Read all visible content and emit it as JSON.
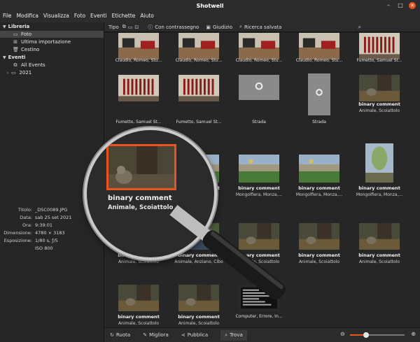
{
  "window": {
    "title": "Shotwell"
  },
  "menu": [
    "File",
    "Modifica",
    "Visualizza",
    "Foto",
    "Eventi",
    "Etichette",
    "Aiuto"
  ],
  "sidebar": {
    "libreria_label": "Libreria",
    "items": [
      {
        "label": "Foto",
        "icon": "photo-icon",
        "selected": true
      },
      {
        "label": "Ultima importazione",
        "icon": "import-icon",
        "selected": false
      },
      {
        "label": "Cestino",
        "icon": "trash-icon",
        "selected": false
      }
    ],
    "eventi_label": "Eventi",
    "events": [
      {
        "label": "All Events",
        "icon": "events-icon"
      },
      {
        "label": "2021",
        "icon": "folder-icon"
      }
    ]
  },
  "metadata": [
    {
      "key": "Titolo:",
      "value": "_DSC0089.JPG"
    },
    {
      "key": "Data:",
      "value": "sab 25 set 2021"
    },
    {
      "key": "Ora:",
      "value": "9:39:01"
    },
    {
      "key": "Dimensione:",
      "value": "4780 × 3183"
    },
    {
      "key": "Esposizione:",
      "value": "1/80 s, ƒ/5"
    },
    {
      "key": "",
      "value": "ISO 800"
    }
  ],
  "toolbar": {
    "tipo_label": "Tipo",
    "flagged_label": "Con contrassegno",
    "rating_label": "Giudizio",
    "saved_search_label": "Ricerca salvata"
  },
  "grid": {
    "rows": [
      [
        {
          "line1": "Claudio, Romeo, Stu...",
          "line2": "",
          "bold": false,
          "thumb": "classroom"
        },
        {
          "line1": "Claudio, Romeo, Stu...",
          "line2": "",
          "bold": false,
          "thumb": "classroom"
        },
        {
          "line1": "Claudio, Romeo, Stu...",
          "line2": "",
          "bold": false,
          "thumb": "classroom"
        },
        {
          "line1": "Claudio, Romeo, Stu...",
          "line2": "",
          "bold": false,
          "thumb": "classroom"
        },
        {
          "line1": "Fumetto, Samuel St...",
          "line2": "",
          "bold": false,
          "thumb": "curtain"
        }
      ],
      [
        {
          "line1": "Fumetto, Samuel St...",
          "line2": "",
          "bold": false,
          "thumb": "curtain"
        },
        {
          "line1": "Fumetto, Samuel St...",
          "line2": "",
          "bold": false,
          "thumb": "curtain"
        },
        {
          "line1": "Strada",
          "line2": "",
          "bold": false,
          "thumb": "road"
        },
        {
          "line1": "Strada",
          "line2": "",
          "bold": false,
          "thumb": "road"
        },
        {
          "line1": "binary comment",
          "line2": "Animale, Scoiattolo",
          "bold": true,
          "thumb": "squirrel"
        }
      ],
      [
        {
          "line1": "",
          "line2": "",
          "bold": false,
          "thumb": "hidden"
        },
        {
          "line1": "binary comment",
          "line2": "",
          "bold": true,
          "thumb": "park"
        },
        {
          "line1": "binary comment",
          "line2": "Mongolfiera, Monza,...",
          "bold": true,
          "thumb": "park"
        },
        {
          "line1": "binary comment",
          "line2": "Mongolfiera, Monza,...",
          "bold": true,
          "thumb": "park"
        },
        {
          "line1": "binary comment",
          "line2": "Mongolfiera, Monza,...",
          "bold": true,
          "thumb": "balloon"
        }
      ],
      [
        {
          "line1": "binary comment",
          "line2": "Animale, Scoiattolo",
          "bold": true,
          "thumb": "squirrel"
        },
        {
          "line1": "binary comment",
          "line2": "Animale, Anziano, Cibo",
          "bold": true,
          "thumb": "pond"
        },
        {
          "line1": "binary comment",
          "line2": "Animale, Scoiattolo",
          "bold": true,
          "thumb": "squirrel"
        },
        {
          "line1": "binary comment",
          "line2": "Animale, Scoiattolo",
          "bold": true,
          "thumb": "squirrel"
        },
        {
          "line1": "binary comment",
          "line2": "Animale, Scoiattolo",
          "bold": true,
          "thumb": "squirrel"
        }
      ],
      [
        {
          "line1": "binary comment",
          "line2": "Animale, Scoiattolo",
          "bold": true,
          "thumb": "squirrel"
        },
        {
          "line1": "binary comment",
          "line2": "Animale, Scoiattolo",
          "bold": true,
          "thumb": "squirrel"
        },
        {
          "line1": "Computer, Errore, In...",
          "line2": "",
          "bold": false,
          "thumb": "screen"
        },
        {
          "line1": "",
          "line2": "",
          "bold": false,
          "thumb": "none"
        },
        {
          "line1": "",
          "line2": "",
          "bold": false,
          "thumb": "none"
        }
      ]
    ]
  },
  "magnifier": {
    "line1": "binary comment",
    "line2": "Animale, Scoiattolo"
  },
  "bottombar": {
    "rotate_label": "Ruota",
    "enhance_label": "Migliora",
    "publish_label": "Pubblica",
    "find_label": "Trova",
    "zoom_level": 0.3
  },
  "colors": {
    "accent": "#e95420",
    "background": "#262626",
    "titlebar": "#2c2c2c"
  }
}
